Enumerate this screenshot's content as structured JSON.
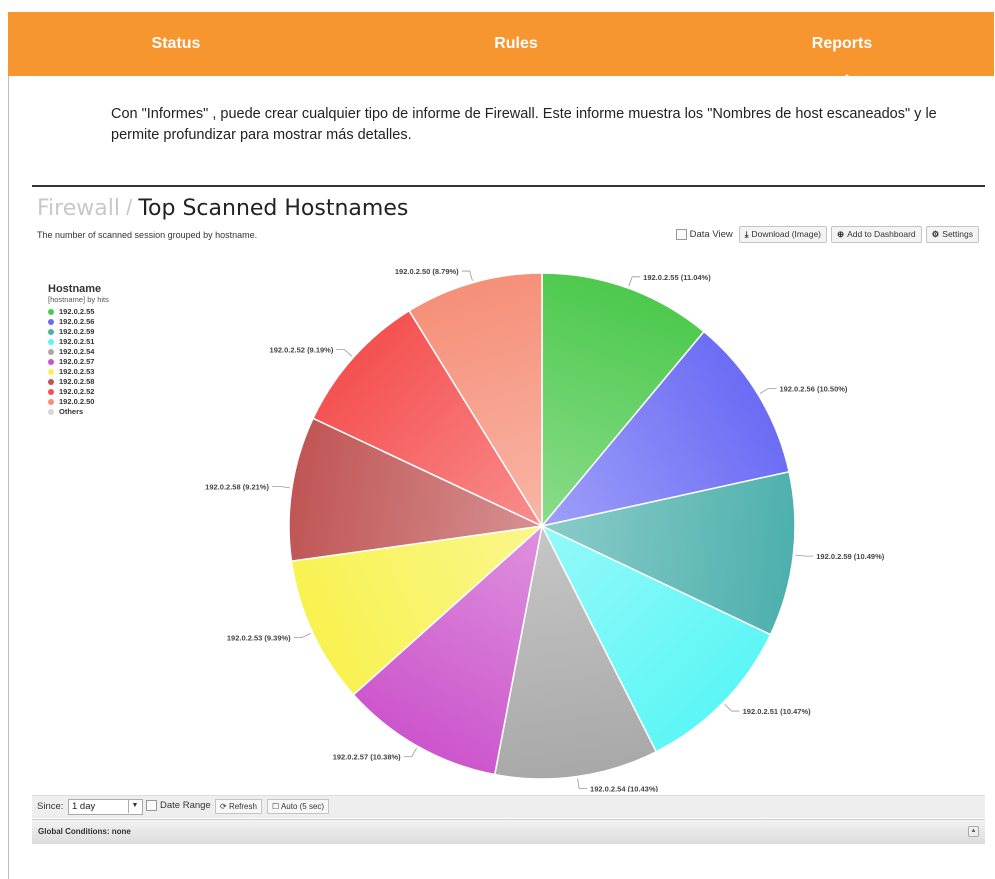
{
  "nav": {
    "items": [
      {
        "label": "Status"
      },
      {
        "label": "Rules"
      },
      {
        "label": "Reports"
      }
    ],
    "active": "Reports",
    "color": "#f7962f"
  },
  "intro": "Con \"Informes\" , puede crear cualquier tipo de informe de Firewall. Este informe muestra los \"Nombres de host escaneados\" y le permite profundizar para mostrar más detalles.",
  "panel": {
    "breadcrumb": "Firewall",
    "separator": "/",
    "title": "Top Scanned Hostnames",
    "description": "The number of scanned session grouped by hostname.",
    "toolbar": {
      "data_view": "Data View",
      "download": "Download (Image)",
      "add_dashboard": "Add to Dashboard",
      "settings": "Settings"
    }
  },
  "chart_data": {
    "type": "pie",
    "legend_title": "Hostname",
    "legend_subtitle": "[hostname] by hits",
    "legend_position": "top-left",
    "slices": [
      {
        "label": "192.0.2.55",
        "value": 11.04,
        "color": "#4cc94c",
        "display": "192.0.2.55 (11.04%)"
      },
      {
        "label": "192.0.2.56",
        "value": 10.5,
        "color": "#6b6bf5",
        "display": "192.0.2.56 (10.50%)"
      },
      {
        "label": "192.0.2.59",
        "value": 10.49,
        "color": "#4db0ad",
        "display": "192.0.2.59 (10.49%)"
      },
      {
        "label": "192.0.2.51",
        "value": 10.47,
        "color": "#5cf6f6",
        "display": "192.0.2.51 (10.47%)"
      },
      {
        "label": "192.0.2.54",
        "value": 10.43,
        "color": "#a8a8a8",
        "display": "192.0.2.54 (10.43%)"
      },
      {
        "label": "192.0.2.57",
        "value": 10.38,
        "color": "#cc55cc",
        "display": "192.0.2.57 (10.38%)"
      },
      {
        "label": "192.0.2.53",
        "value": 9.39,
        "color": "#f8f250",
        "display": "192.0.2.53 (9.39%)"
      },
      {
        "label": "192.0.2.58",
        "value": 9.21,
        "color": "#c05555",
        "display": "192.0.2.58 (9.21%)"
      },
      {
        "label": "192.0.2.52",
        "value": 9.19,
        "color": "#f55050",
        "display": "192.0.2.52 (9.19%)"
      },
      {
        "label": "192.0.2.50",
        "value": 8.79,
        "color": "#f58f78",
        "display": "192.0.2.50 (8.79%)"
      }
    ],
    "others": {
      "label": "Others",
      "color": "#d6d6d6"
    }
  },
  "footer": {
    "since_label": "Since:",
    "since_value": "1 day",
    "date_range": "Date Range",
    "refresh": "Refresh",
    "auto": "Auto (5 sec)",
    "global_conditions": "Global Conditions: none"
  }
}
